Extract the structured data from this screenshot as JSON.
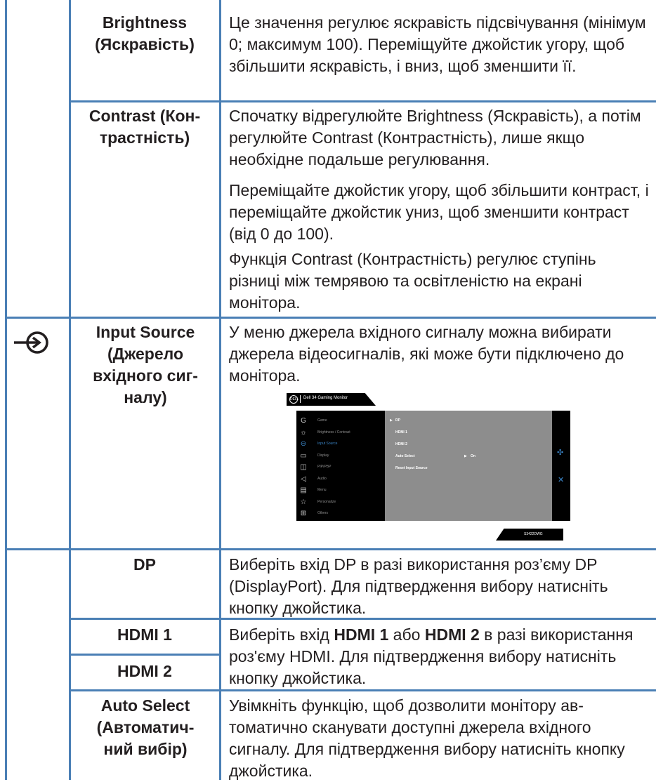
{
  "rows": {
    "brightness": {
      "name": "Brightness (Яскравість)",
      "desc": "Це значення регулює яскравість підсвічування (мінімум 0; максимум 100). Переміщуйте джой­стик угору, щоб збільшити яскравість, і вниз, щоб зменшити її."
    },
    "contrast": {
      "name": "Contrast (Кон­трастність)",
      "desc1": "Спочатку відрегулюйте Brightness (Яскравість), а потім регулюйте Contrast (Контрастність), лише якщо необхідне подальше регулювання.",
      "desc2": "Переміщайте джойстик угору, щоб збільшити контраст, і переміщайте джойстик униз, щоб зменшити контраст (від 0 до 100).",
      "desc3": "Функція Contrast (Контрастність) регулює ступінь різниці між темрявою та освітленістю на екрані монітора."
    },
    "input_source": {
      "icon": "input-source-icon",
      "name": "Input Source (Джерело вхідного сиг­налу)",
      "desc": "У меню джерела вхідного сигналу можна ви­бирати джерела відеосигналів, які може бути підключено до монітора."
    },
    "dp": {
      "name": "DP",
      "desc": "Виберіть вхід DP в разі використання роз’єму DP (DisplayPort). Для підтвердження вибору натис­ніть кнопку джойстика."
    },
    "hdmi": {
      "name1": "HDMI 1",
      "name2": "HDMI 2",
      "desc_a": "Виберіть вхід ",
      "desc_b": "HDMI 1",
      "desc_c": " або ",
      "desc_d": "HDMI 2",
      "desc_e": " в разі викори­стання роз'єму HDMI. Для підтвердження вибору натисніть кнопку джойстика."
    },
    "auto_select": {
      "name": "Auto Select (Автоматич­ний вибір)",
      "desc": "Увімкніть функцію, щоб дозволити монітору ав­томатично сканувати доступні джерела вхідного сигналу. Для підтвердження вибору натисніть кнопку джойстика."
    }
  },
  "osd": {
    "logo": "DELL",
    "title": "Dell 34 Gaming Monitor",
    "menu": [
      {
        "icon": "game-icon",
        "glyph": "G",
        "label": "Game"
      },
      {
        "icon": "brightness-icon",
        "glyph": "☼",
        "label": "Brightness / Contrast"
      },
      {
        "icon": "input-source-icon",
        "glyph": "⊖",
        "label": "Input Source",
        "active": true
      },
      {
        "icon": "display-icon",
        "glyph": "▭",
        "label": "Display"
      },
      {
        "icon": "pip-pbp-icon",
        "glyph": "◫",
        "label": "PIP/PBP"
      },
      {
        "icon": "audio-icon",
        "glyph": "◁",
        "label": "Audio"
      },
      {
        "icon": "menu-icon",
        "glyph": "▤",
        "label": "Menu"
      },
      {
        "icon": "personalize-icon",
        "glyph": "☆",
        "label": "Personalize"
      },
      {
        "icon": "others-icon",
        "glyph": "⊞",
        "label": "Others"
      }
    ],
    "options": [
      "DP",
      "HDMI 1",
      "HDMI 2",
      "Auto Select",
      "Reset Input Source"
    ],
    "auto_select_value": "On",
    "model": "S3422DWG",
    "nav_icon": "joystick-icon",
    "close_icon": "close-icon"
  },
  "colors": {
    "border": "#4a7fb5",
    "text": "#231f20",
    "osd_accent": "#3b86c9"
  }
}
